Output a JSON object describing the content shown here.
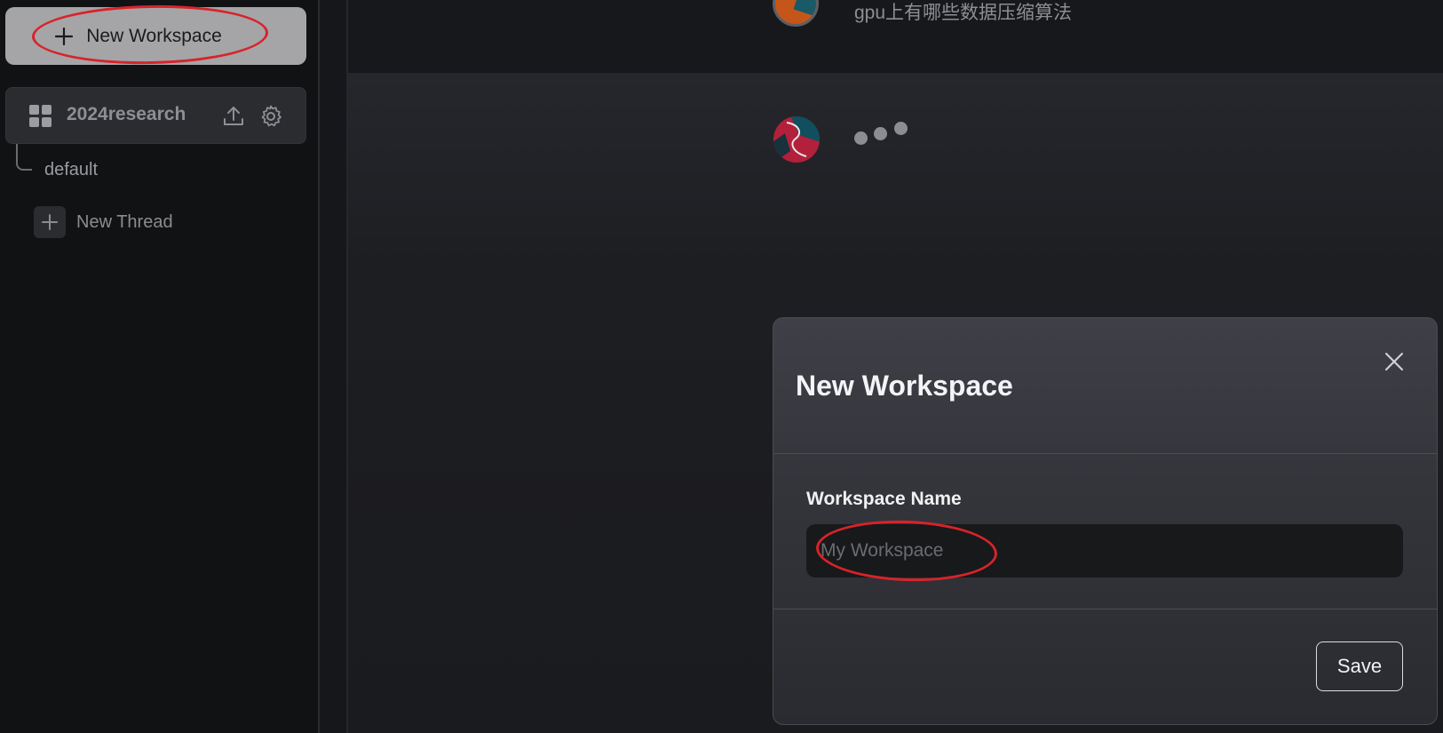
{
  "sidebar": {
    "new_workspace_label": "New Workspace",
    "workspace": {
      "name": "2024research",
      "threads": [
        {
          "label": "default"
        }
      ],
      "new_thread_label": "New Thread"
    }
  },
  "chat": {
    "user_message": "gpu上有哪些数据压缩算法"
  },
  "modal": {
    "title": "New Workspace",
    "field_label": "Workspace Name",
    "field_placeholder": "My Workspace",
    "field_value": "",
    "save_label": "Save"
  },
  "colors": {
    "annotation_red": "#d8232a",
    "sidebar_button": "#a5a5a7",
    "modal_bg": "#3a3b41",
    "input_bg": "#18191b"
  },
  "icons": {
    "new_workspace": "plus-icon",
    "workspace": "grid-icon",
    "upload": "upload-icon",
    "settings": "gear-icon",
    "new_thread": "plus-icon",
    "close": "close-icon"
  }
}
